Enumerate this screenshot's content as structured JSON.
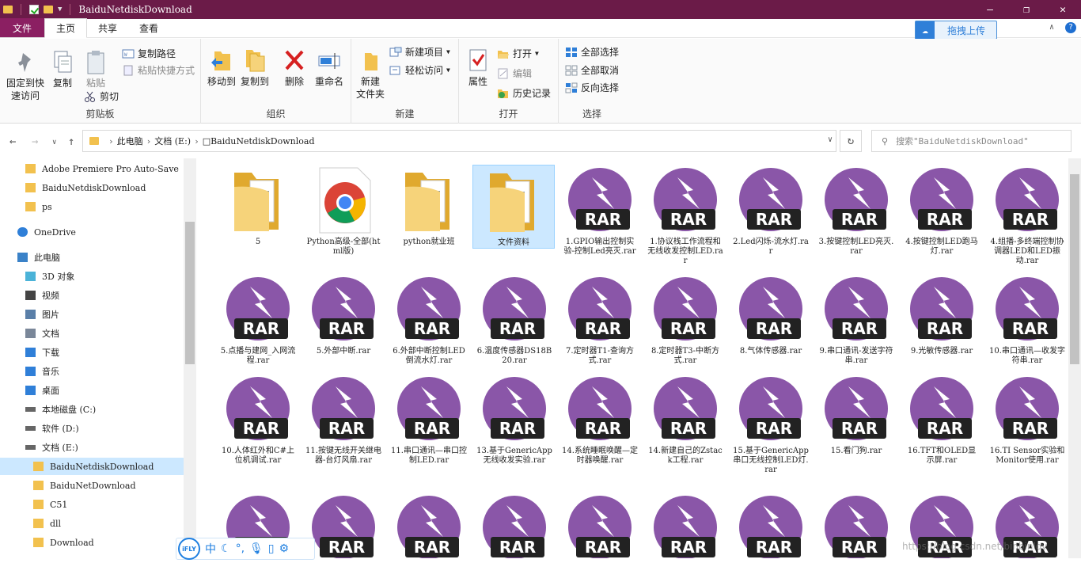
{
  "window": {
    "title": "BaiduNetdiskDownload"
  },
  "tabs": [
    "文件",
    "主页",
    "共享",
    "查看"
  ],
  "upload_label": "拖拽上传",
  "ribbon": {
    "clipboard": {
      "label": "剪贴板",
      "pin": "固定到快速访问",
      "copy": "复制",
      "paste": "粘贴",
      "copy_path": "复制路径",
      "paste_shortcut": "粘贴快捷方式",
      "cut": "剪切"
    },
    "organize": {
      "label": "组织",
      "move_to": "移动到",
      "copy_to": "复制到",
      "delete": "删除",
      "rename": "重命名"
    },
    "new": {
      "label": "新建",
      "new_folder": "新建\n文件夹",
      "new_item": "新建项目",
      "easy_access": "轻松访问"
    },
    "open": {
      "label": "打开",
      "properties": "属性",
      "open": "打开",
      "edit": "编辑",
      "history": "历史记录"
    },
    "select": {
      "label": "选择",
      "select_all": "全部选择",
      "select_none": "全部取消",
      "invert": "反向选择"
    }
  },
  "address": {
    "crumbs": [
      "此电脑",
      "文档 (E:)",
      "□BaiduNetdiskDownload"
    ],
    "search_placeholder": "搜索\"BaiduNetdiskDownload\""
  },
  "sidebar": [
    {
      "label": "Adobe Premiere Pro Auto-Save",
      "icon": "folder-icon",
      "indent": 1
    },
    {
      "label": "BaiduNetdiskDownload",
      "icon": "folder-icon",
      "indent": 1
    },
    {
      "label": "ps",
      "icon": "folder-icon",
      "indent": 1
    },
    {
      "label": "OneDrive",
      "icon": "cloud-icon",
      "indent": 0
    },
    {
      "label": "此电脑",
      "icon": "computer-icon",
      "indent": 0
    },
    {
      "label": "3D 对象",
      "icon": "cube-icon",
      "indent": 1
    },
    {
      "label": "视频",
      "icon": "video-icon",
      "indent": 1
    },
    {
      "label": "图片",
      "icon": "picture-icon",
      "indent": 1
    },
    {
      "label": "文档",
      "icon": "document-icon",
      "indent": 1
    },
    {
      "label": "下载",
      "icon": "download-icon",
      "indent": 1
    },
    {
      "label": "音乐",
      "icon": "music-icon",
      "indent": 1
    },
    {
      "label": "桌面",
      "icon": "desktop-icon",
      "indent": 1
    },
    {
      "label": "本地磁盘 (C:)",
      "icon": "drive-icon",
      "indent": 1
    },
    {
      "label": "软件 (D:)",
      "icon": "drive-icon",
      "indent": 1
    },
    {
      "label": "文档 (E:)",
      "icon": "drive-icon",
      "indent": 1
    },
    {
      "label": "BaiduNetdiskDownload",
      "icon": "folder-icon",
      "indent": 2,
      "selected": true
    },
    {
      "label": "BaiduNetDownload",
      "icon": "folder-icon",
      "indent": 2
    },
    {
      "label": "C51",
      "icon": "folder-icon",
      "indent": 2
    },
    {
      "label": "dll",
      "icon": "folder-icon",
      "indent": 2
    },
    {
      "label": "Download",
      "icon": "folder-icon",
      "indent": 2
    }
  ],
  "files": [
    {
      "name": "5",
      "type": "folder"
    },
    {
      "name": "Python高级-全部(html版)",
      "type": "chrome"
    },
    {
      "name": "python就业班",
      "type": "folder"
    },
    {
      "name": "文件资料",
      "type": "folder",
      "selected": true
    },
    {
      "name": "1.GPIO输出控制实验-控制Led亮灭.rar",
      "type": "rar"
    },
    {
      "name": "1.协议栈工作流程和无线收发控制LED.rar",
      "type": "rar"
    },
    {
      "name": "2.Led闪烁-流水灯.rar",
      "type": "rar"
    },
    {
      "name": "3.按键控制LED亮灭.rar",
      "type": "rar"
    },
    {
      "name": "4.按键控制LED跑马灯.rar",
      "type": "rar"
    },
    {
      "name": "4.组播-多终端控制协调器LED和LED振动.rar",
      "type": "rar"
    },
    {
      "name": "5.点播与建网_入网流程.rar",
      "type": "rar"
    },
    {
      "name": "5.外部中断.rar",
      "type": "rar"
    },
    {
      "name": "6.外部中断控制LED倒流水灯.rar",
      "type": "rar"
    },
    {
      "name": "6.温度传感器DS18B20.rar",
      "type": "rar"
    },
    {
      "name": "7.定时器T1-查询方式.rar",
      "type": "rar"
    },
    {
      "name": "8.定时器T3-中断方式.rar",
      "type": "rar"
    },
    {
      "name": "8.气体传感器.rar",
      "type": "rar"
    },
    {
      "name": "9.串口通讯-发送字符串.rar",
      "type": "rar"
    },
    {
      "name": "9.光敏传感器.rar",
      "type": "rar"
    },
    {
      "name": "10.串口通讯—收发字符串.rar",
      "type": "rar"
    },
    {
      "name": "10.人体红外和C#上位机调试.rar",
      "type": "rar"
    },
    {
      "name": "11.按键无线开关继电器-台灯风扇.rar",
      "type": "rar"
    },
    {
      "name": "11.串口通讯—串口控制LED.rar",
      "type": "rar"
    },
    {
      "name": "13.基于GenericApp无线收发实验.rar",
      "type": "rar"
    },
    {
      "name": "14.系统睡眠唤醒—定时器唤醒.rar",
      "type": "rar"
    },
    {
      "name": "14.新建自己的Zstack工程.rar",
      "type": "rar"
    },
    {
      "name": "15.基于GenericApp串口无线控制LED灯.rar",
      "type": "rar"
    },
    {
      "name": "15.看门狗.rar",
      "type": "rar"
    },
    {
      "name": "16.TFT和OLED显示屏.rar",
      "type": "rar"
    },
    {
      "name": "16.TI Sensor实验和Monitor使用.rar",
      "type": "rar"
    },
    {
      "name": "",
      "type": "rar"
    },
    {
      "name": "",
      "type": "rar"
    },
    {
      "name": "",
      "type": "rar"
    },
    {
      "name": "",
      "type": "rar"
    },
    {
      "name": "",
      "type": "rar"
    },
    {
      "name": "",
      "type": "rar"
    },
    {
      "name": "",
      "type": "rar"
    },
    {
      "name": "",
      "type": "rar"
    },
    {
      "name": "",
      "type": "rar"
    },
    {
      "name": "",
      "type": "rar"
    }
  ],
  "rar_tag": "RAR",
  "ime": {
    "logo": "iFLY",
    "lang": "中"
  },
  "watermark": "https://blog.csdn.net/binbinlov"
}
